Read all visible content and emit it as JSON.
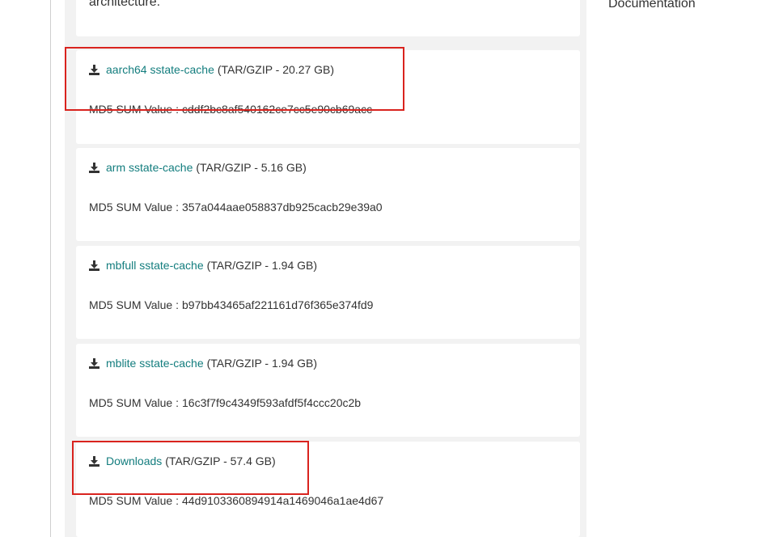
{
  "intro": {
    "text": "architecture."
  },
  "sidebar": {
    "link": "Documentation"
  },
  "downloads": [
    {
      "name": "aarch64 sstate-cache",
      "meta": "(TAR/GZIP - 20.27 GB)",
      "md5_label": "MD5 SUM Value :",
      "md5": "cddf2bc8af540162ce7cc5e90cb69acc"
    },
    {
      "name": "arm sstate-cache",
      "meta": "(TAR/GZIP - 5.16 GB)",
      "md5_label": "MD5 SUM Value :",
      "md5": "357a044aae058837db925cacb29e39a0"
    },
    {
      "name": "mbfull sstate-cache",
      "meta": "(TAR/GZIP - 1.94 GB)",
      "md5_label": "MD5 SUM Value :",
      "md5": "b97bb43465af221161d76f365e374fd9"
    },
    {
      "name": "mblite sstate-cache",
      "meta": "(TAR/GZIP - 1.94 GB)",
      "md5_label": "MD5 SUM Value :",
      "md5": "16c3f7f9c4349f593afdf5f4ccc20c2b"
    },
    {
      "name": "Downloads",
      "meta": "(TAR/GZIP - 57.4 GB)",
      "md5_label": "MD5 SUM Value :",
      "md5": "44d9103360894914a1469046a1ae4d67"
    }
  ],
  "colors": {
    "link": "#137d7e",
    "highlight": "#d9231e",
    "page_bg": "#f2f2f2"
  }
}
